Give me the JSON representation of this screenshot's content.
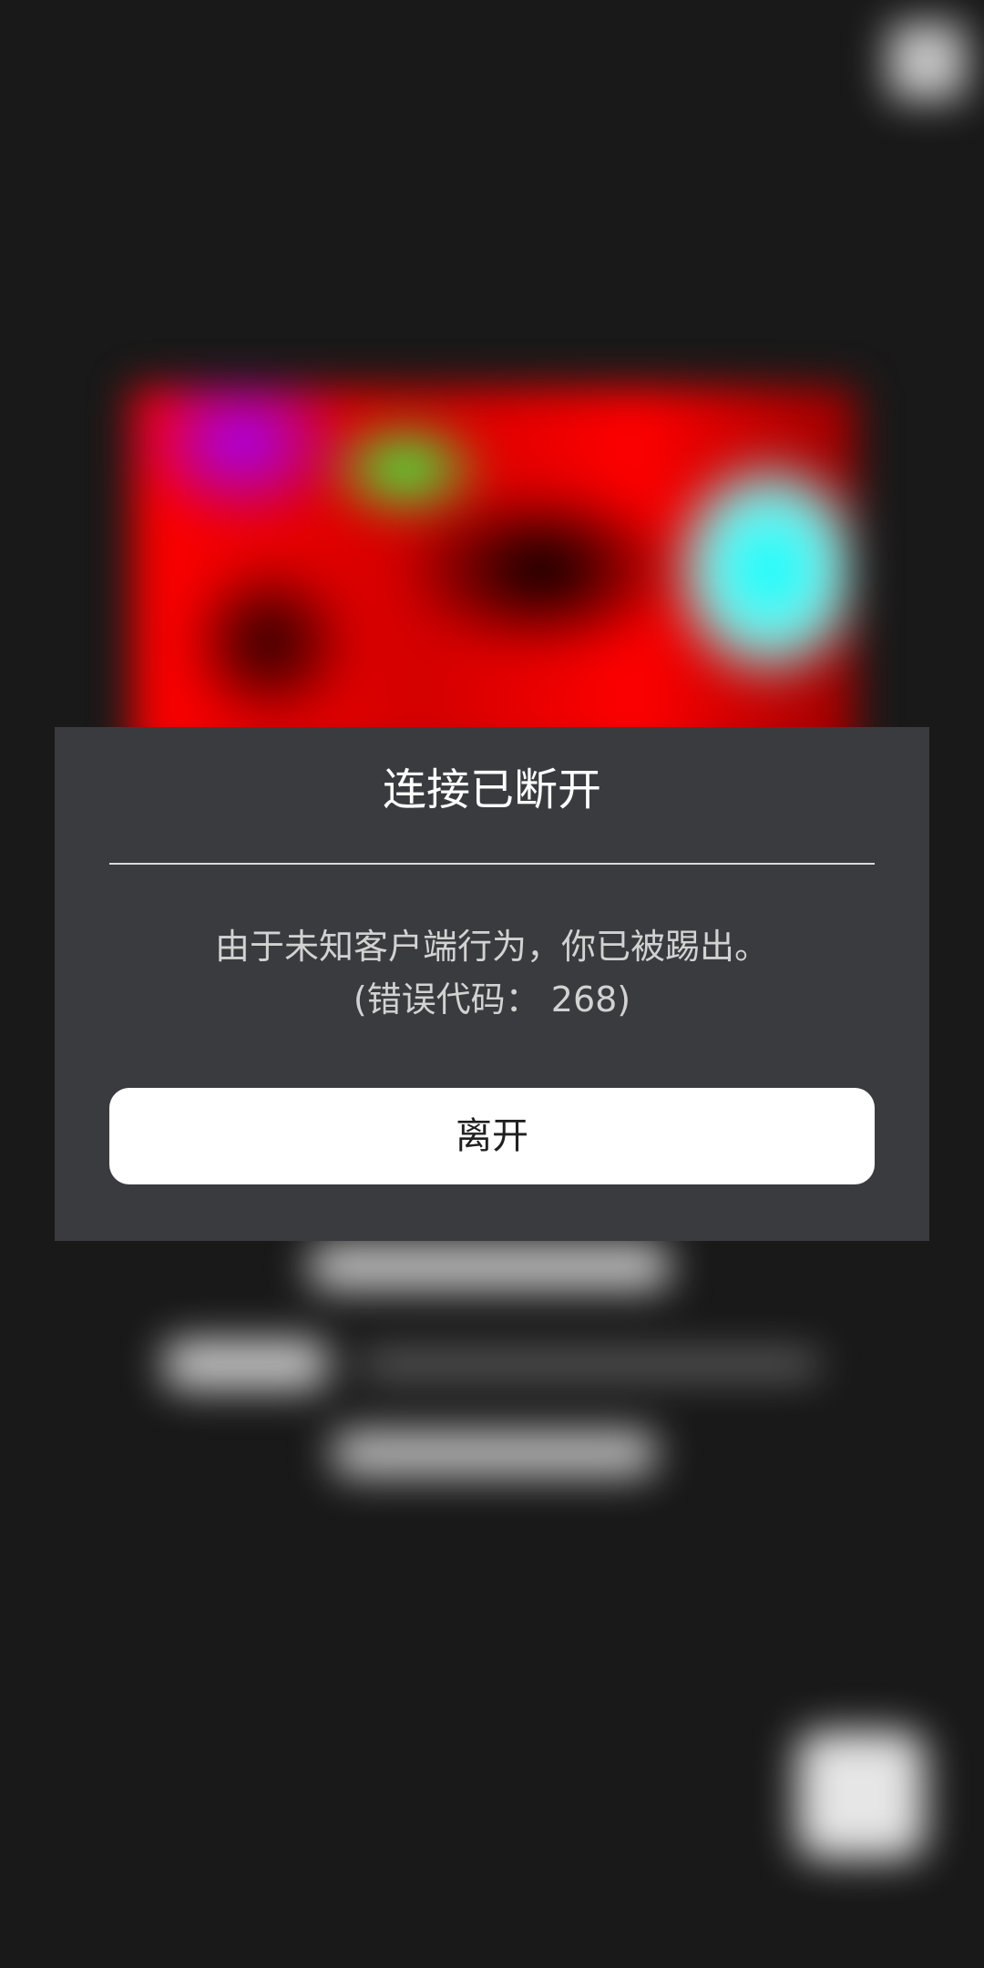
{
  "dialog": {
    "title": "连接已断开",
    "message_line1": "由于未知客户端行为，你已被踢出。",
    "message_line2": "(错误代码： 268)",
    "leave_button_label": "离开"
  },
  "colors": {
    "screen_background": "#191919",
    "dialog_background": "#3a3b3e",
    "button_background": "#ffffff",
    "title_text": "#ffffff",
    "message_text": "#d2d2d2"
  },
  "background": {
    "icons": [
      "close-icon"
    ]
  }
}
